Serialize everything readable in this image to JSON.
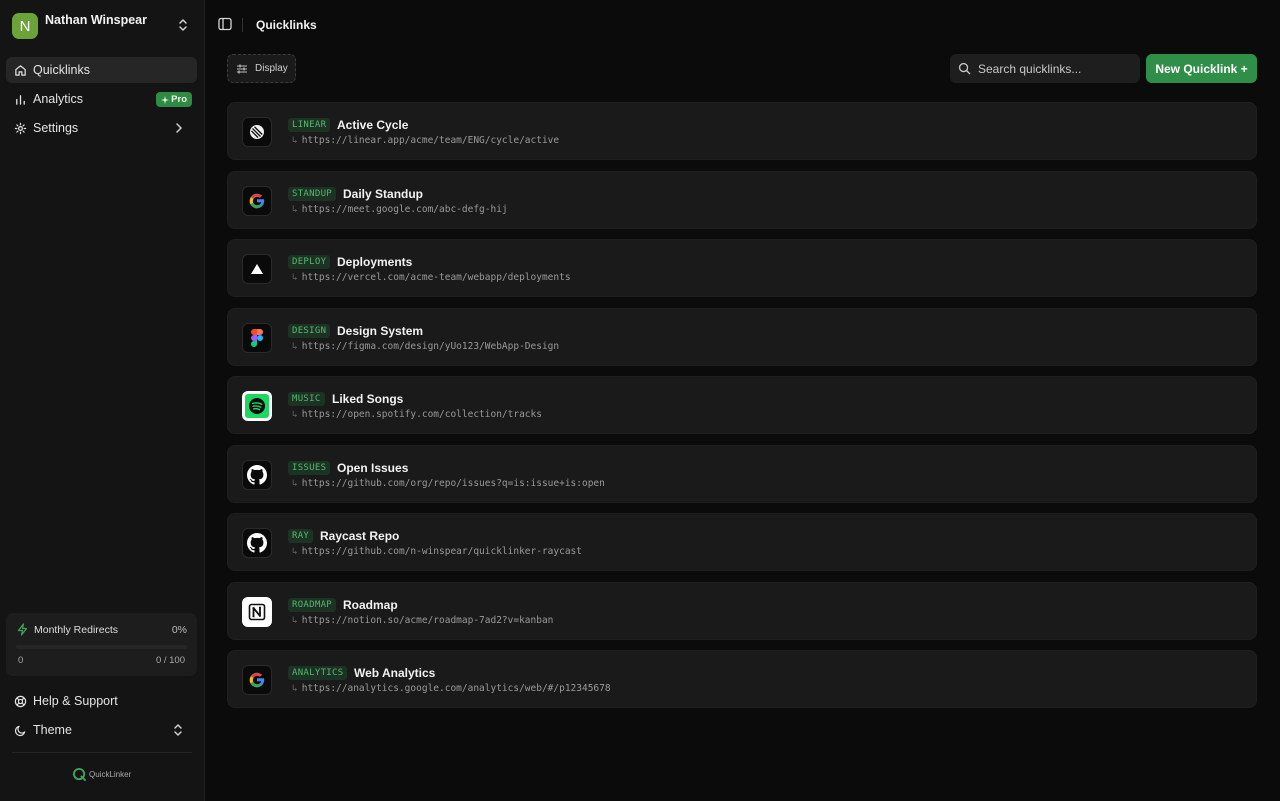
{
  "user": {
    "initial": "N",
    "name": "Nathan Winspear"
  },
  "nav": [
    {
      "label": "Quicklinks",
      "active": true
    },
    {
      "label": "Analytics",
      "badge": "Pro"
    },
    {
      "label": "Settings"
    }
  ],
  "usage": {
    "title": "Monthly Redirects",
    "percent": "0%",
    "min": "0",
    "max": "0 / 100",
    "fill": 0
  },
  "bottom_nav": [
    {
      "label": "Help & Support"
    },
    {
      "label": "Theme"
    }
  ],
  "brand": {
    "name": "QuickLinker"
  },
  "header": {
    "title": "Quicklinks"
  },
  "toolbar": {
    "display_label": "Display",
    "search_placeholder": "Search quicklinks...",
    "new_label": "New Quicklink +"
  },
  "colors": {
    "accent": "#2f8f49",
    "tag_text": "#56b870",
    "tag_bg": "#1c3323"
  },
  "quicklinks": [
    {
      "tag": "LINEAR",
      "title": "Active Cycle",
      "url": "https://linear.app/acme/team/ENG/cycle/active",
      "icon": "linear-icon"
    },
    {
      "tag": "STANDUP",
      "title": "Daily Standup",
      "url": "https://meet.google.com/abc-defg-hij",
      "icon": "google-icon"
    },
    {
      "tag": "DEPLOY",
      "title": "Deployments",
      "url": "https://vercel.com/acme-team/webapp/deployments",
      "icon": "vercel-icon"
    },
    {
      "tag": "DESIGN",
      "title": "Design System",
      "url": "https://figma.com/design/yUo123/WebApp-Design",
      "icon": "figma-icon"
    },
    {
      "tag": "MUSIC",
      "title": "Liked Songs",
      "url": "https://open.spotify.com/collection/tracks",
      "icon": "spotify-icon"
    },
    {
      "tag": "ISSUES",
      "title": "Open Issues",
      "url": "https://github.com/org/repo/issues?q=is:issue+is:open",
      "icon": "github-icon"
    },
    {
      "tag": "RAY",
      "title": "Raycast Repo",
      "url": "https://github.com/n-winspear/quicklinker-raycast",
      "icon": "github-icon"
    },
    {
      "tag": "ROADMAP",
      "title": "Roadmap",
      "url": "https://notion.so/acme/roadmap-7ad2?v=kanban",
      "icon": "notion-icon"
    },
    {
      "tag": "ANALYTICS",
      "title": "Web Analytics",
      "url": "https://analytics.google.com/analytics/web/#/p12345678",
      "icon": "google-icon"
    }
  ]
}
